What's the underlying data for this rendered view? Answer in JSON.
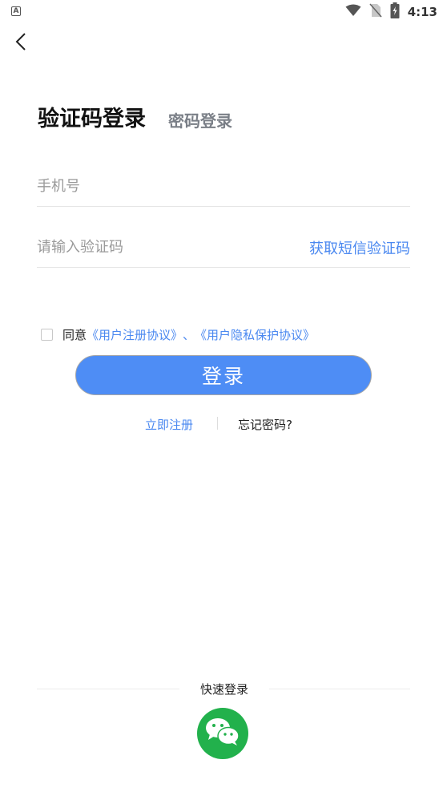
{
  "status_bar": {
    "left_icon": "A",
    "time": "4:13",
    "icons": [
      "wifi-icon",
      "no-sim-icon",
      "battery-charging-icon"
    ]
  },
  "nav": {
    "back_icon": "chevron-left-icon"
  },
  "tabs": {
    "active_label": "验证码登录",
    "inactive_label": "密码登录"
  },
  "form": {
    "phone_placeholder": "手机号",
    "code_placeholder": "请输入验证码",
    "sms_button_label": "获取短信验证码"
  },
  "agreement": {
    "prefix": "同意",
    "user_agreement": "《用户注册协议》",
    "separator": "、",
    "privacy_policy": "《用户隐私保护协议》"
  },
  "login_button_label": "登录",
  "links": {
    "register": "立即注册",
    "forgot": "忘记密码?"
  },
  "quick_login": {
    "label": "快速登录",
    "wechat_icon": "wechat-icon"
  },
  "colors": {
    "accent": "#4a88f0",
    "button": "#4e8df5",
    "wechat": "#22b14c"
  }
}
